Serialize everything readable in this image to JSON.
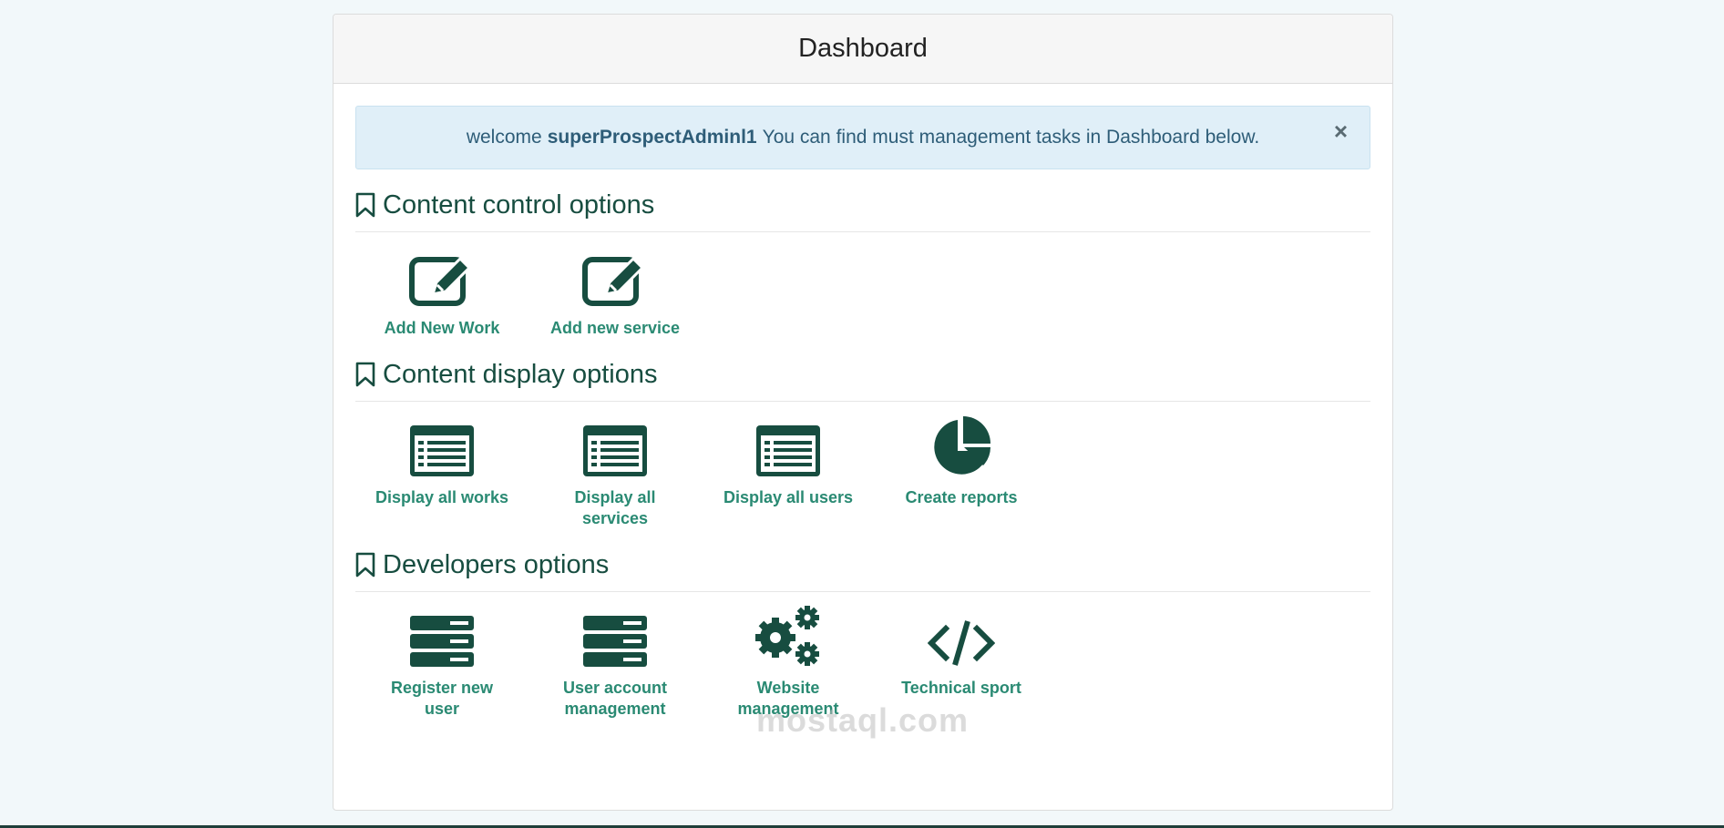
{
  "header": {
    "title": "Dashboard"
  },
  "alert": {
    "prefix": "welcome",
    "username": "superProspectAdminl1",
    "message": "You can find must management tasks in Dashboard below.",
    "close": "×"
  },
  "sections": [
    {
      "title": "Content control options",
      "items": [
        {
          "label": "Add New Work",
          "icon": "edit-icon"
        },
        {
          "label": "Add new service",
          "icon": "edit-icon"
        }
      ]
    },
    {
      "title": "Content display options",
      "items": [
        {
          "label": "Display all works",
          "icon": "list-icon"
        },
        {
          "label": "Display all services",
          "icon": "list-icon"
        },
        {
          "label": "Display all users",
          "icon": "list-icon"
        },
        {
          "label": "Create reports",
          "icon": "pie-chart-icon"
        }
      ]
    },
    {
      "title": "Developers options",
      "items": [
        {
          "label": "Register new user",
          "icon": "server-icon"
        },
        {
          "label": "User account management",
          "icon": "server-icon"
        },
        {
          "label": "Website management",
          "icon": "gears-icon"
        },
        {
          "label": "Technical sport",
          "icon": "code-icon"
        }
      ]
    }
  ],
  "watermark": "mostaql.com",
  "colors": {
    "icon": "#174d40",
    "link": "#2a8a73",
    "alert_bg": "#e0eff8"
  }
}
